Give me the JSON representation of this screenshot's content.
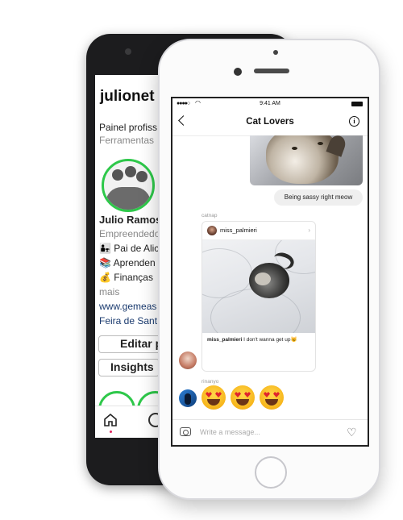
{
  "back_profile": {
    "username": "julionet",
    "panel_label": "Painel profiss",
    "tools_label": "Ferramentas",
    "name": "Julio Ramos",
    "bio_line_1": "Empreendedo",
    "bio_line_2": "👨‍👧 Pai de Alic",
    "bio_line_3": "📚 Aprenden",
    "bio_line_4": "💰 Finanças",
    "bio_more": "mais",
    "link": "www.gemeas",
    "location": "Feira de Sant",
    "edit_profile_label": "Editar p",
    "insights_label": "Insights"
  },
  "chat": {
    "status_time": "9:41 AM",
    "title": "Cat Lovers",
    "sent_message": "Being sassy right meow",
    "sender_1": "catnap",
    "shared_post_user": "miss_palmieri",
    "shared_post_caption_user": "miss_palmieri",
    "shared_post_caption_text": "I don't wanna get up😼",
    "sender_2": "rinanyo",
    "emoji_reaction": "😻😻😻",
    "composer_placeholder": "Write a message..."
  },
  "icons": {
    "back": "chevron-left-icon",
    "info": "info-icon",
    "camera": "camera-icon",
    "heart": "heart-icon",
    "home": "home-icon"
  }
}
